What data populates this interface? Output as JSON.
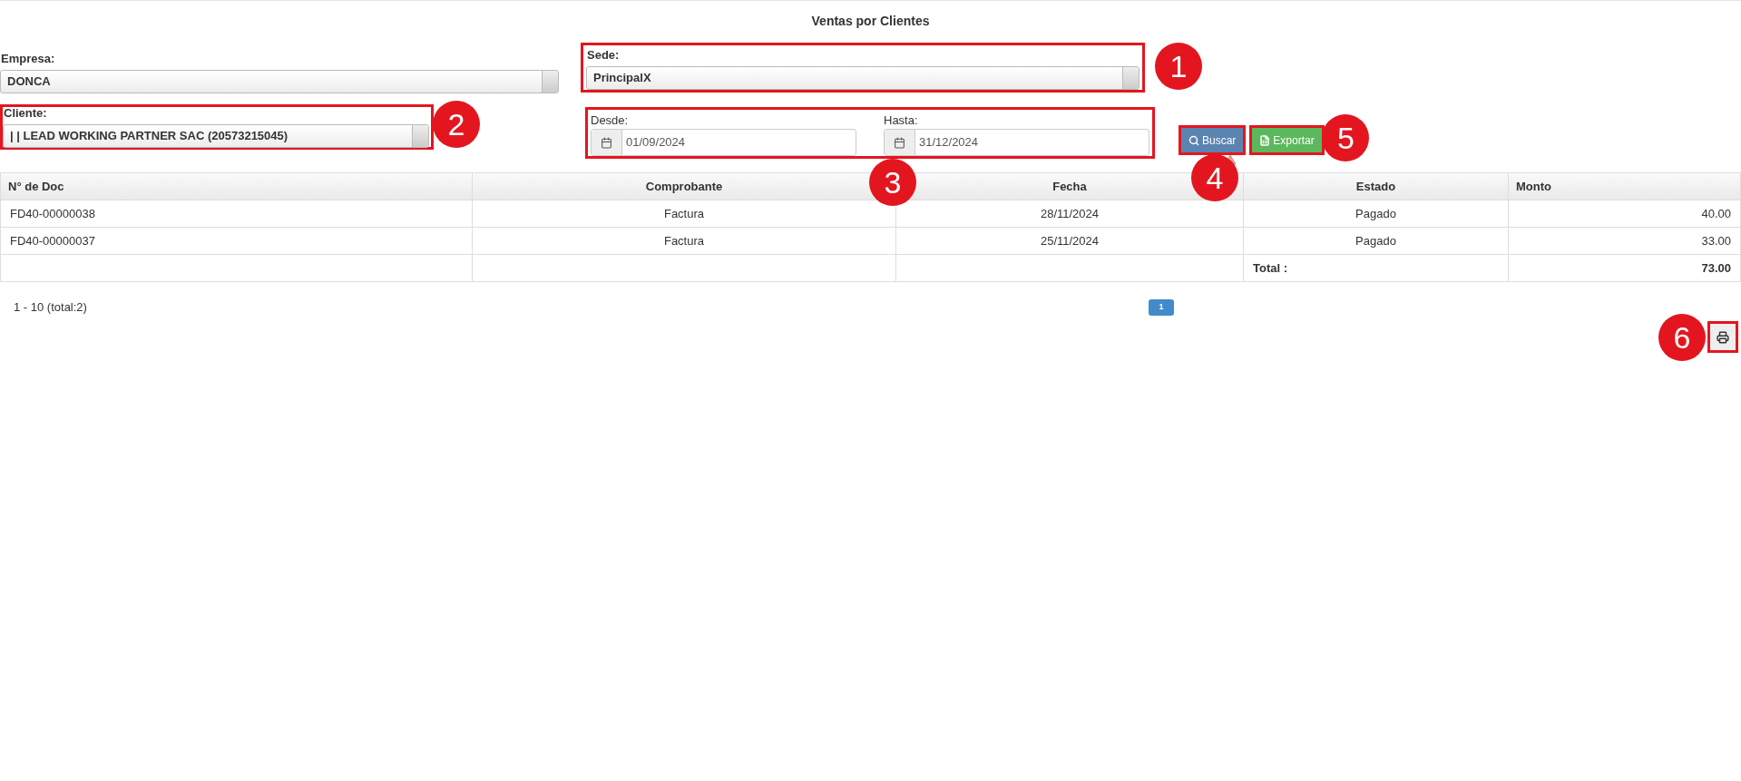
{
  "title": "Ventas por Clientes",
  "empresa": {
    "label": "Empresa:",
    "value": "DONCA"
  },
  "sede": {
    "label": "Sede:",
    "value": "PrincipalX",
    "callout": "1"
  },
  "cliente": {
    "label": "Cliente:",
    "value": "| | LEAD WORKING PARTNER SAC (20573215045)",
    "callout": "2"
  },
  "dates": {
    "callout": "3",
    "fields": [
      {
        "label": "Desde:",
        "value": "01/09/2024"
      },
      {
        "label": "Hasta:",
        "value": "31/12/2024"
      }
    ]
  },
  "buttons": [
    {
      "kind": "search",
      "label": "Buscar",
      "callout": "4"
    },
    {
      "kind": "export",
      "label": "Exportar",
      "callout": "5"
    }
  ],
  "table": {
    "columns": [
      "N° de Doc",
      "Comprobante",
      "Fecha",
      "Estado",
      "Monto"
    ],
    "rows": [
      [
        "FD40-00000038",
        "Factura",
        "28/11/2024",
        "Pagado",
        "40.00"
      ],
      [
        "FD40-00000037",
        "Factura",
        "25/11/2024",
        "Pagado",
        "33.00"
      ]
    ],
    "total_label": "Total :",
    "total": "73.00"
  },
  "range": "1 - 10 (total:2)",
  "pages": [
    {
      "label": "1",
      "selected": true
    }
  ],
  "print": {
    "callout": "6"
  }
}
